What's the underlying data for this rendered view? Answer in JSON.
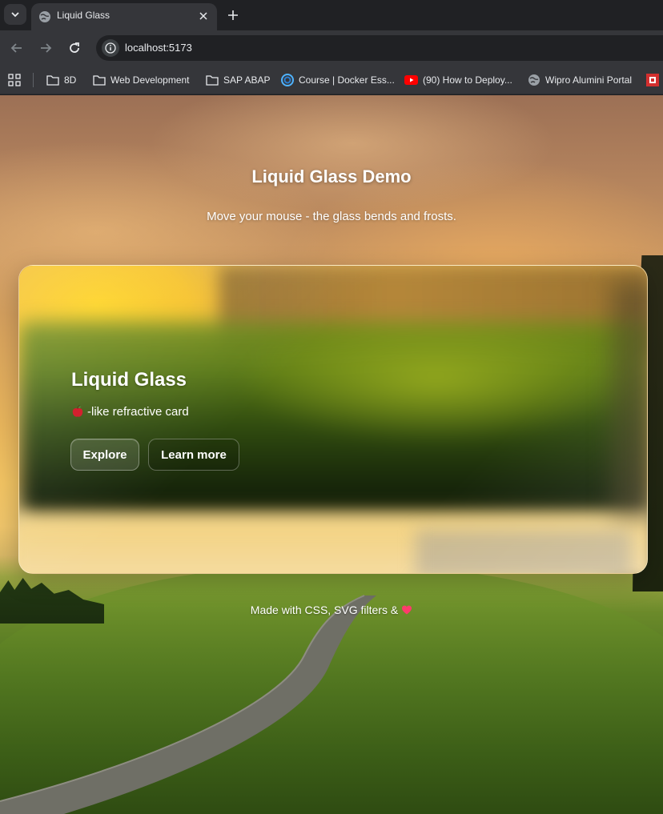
{
  "browser": {
    "tab_title": "Liquid Glass",
    "url": "localhost:5173",
    "bookmarks": [
      {
        "label": "8D",
        "icon": "folder-icon"
      },
      {
        "label": "Web Development",
        "icon": "folder-icon"
      },
      {
        "label": "SAP ABAP",
        "icon": "folder-icon"
      },
      {
        "label": "Course | Docker Ess...",
        "icon": "course-icon"
      },
      {
        "label": "(90) How to Deploy...",
        "icon": "youtube-icon"
      },
      {
        "label": "Wipro Alumini Portal",
        "icon": "globe-icon"
      }
    ]
  },
  "page": {
    "heading": "Liquid Glass Demo",
    "subheading": "Move your mouse - the glass bends and frosts.",
    "card": {
      "title": "Liquid Glass",
      "subtitle": "-like refractive card",
      "subtitle_icon": "apple-icon",
      "primary_button": "Explore",
      "secondary_button": "Learn more"
    },
    "footer": {
      "text": "Made with CSS, SVG filters &",
      "icon": "heart-icon"
    }
  },
  "colors": {
    "chrome_dark": "#202124",
    "chrome_toolbar": "#35363a",
    "text_light": "#e8eaed",
    "youtube_red": "#ff0000"
  }
}
